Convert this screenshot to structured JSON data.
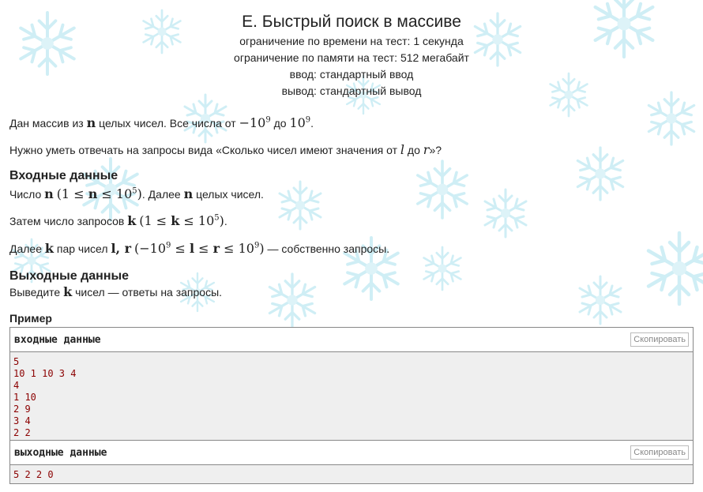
{
  "problem": {
    "title": "E. Быстрый поиск в массиве",
    "time_limit": "ограничение по времени на тест: 1 секунда",
    "memory_limit": "ограничение по памяти на тест: 512 мегабайт",
    "input": "ввод: стандартный ввод",
    "output": "вывод: стандартный вывод"
  },
  "statement": {
    "p1_a": "Дан массив из ",
    "p1_b": " целых чисел. Все числа от ",
    "p1_c": " до ",
    "p2_a": "Нужно уметь отвечать на запросы вида «Сколько чисел имеют значения от ",
    "p2_b": " до ",
    "p2_c": "»?"
  },
  "input_section": {
    "title": "Входные данные",
    "l1_a": "Число ",
    "l1_b": ". Далее ",
    "l1_c": " целых чисел.",
    "l2_a": "Затем число запросов ",
    "l3_a": "Далее ",
    "l3_b": " пар чисел ",
    "l3_c": " — собственно запросы."
  },
  "output_section": {
    "title": "Выходные данные",
    "l1_a": "Выведите ",
    "l1_b": " чисел — ответы на запросы."
  },
  "example": {
    "title": "Пример",
    "input_title": "входные данные",
    "output_title": "выходные данные",
    "copy_label": "Скопировать",
    "input_lines": [
      "5",
      "10 1 10 3 4",
      "4",
      "1 10",
      "2 9",
      "3 4",
      "2 2"
    ],
    "output_lines": [
      "5 2 2 0"
    ]
  }
}
